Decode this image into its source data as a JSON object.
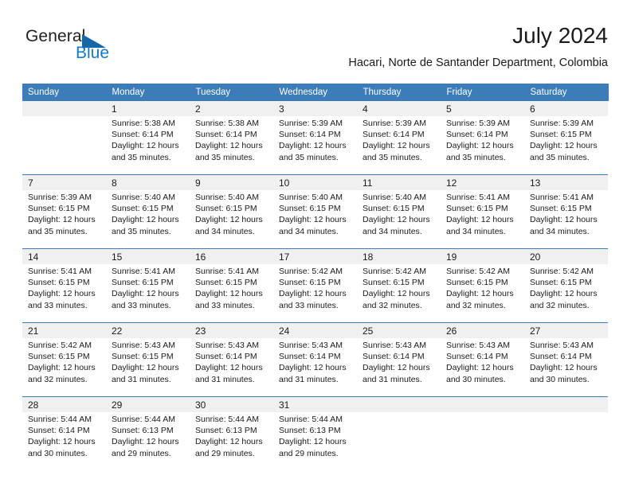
{
  "brand": {
    "name_part1": "General",
    "name_part2": "Blue",
    "logo_icon": "blue-triangle-icon"
  },
  "header": {
    "title": "July 2024",
    "subtitle": "Hacari, Norte de Santander Department, Colombia"
  },
  "colors": {
    "header_blue": "#3b7cb9",
    "brand_blue": "#1379c4",
    "logo_triangle_blue": "#1767a8",
    "date_band_gray": "#f0f0f0",
    "text": "#1a1a1a"
  },
  "calendar": {
    "weekday_headers": [
      "Sunday",
      "Monday",
      "Tuesday",
      "Wednesday",
      "Thursday",
      "Friday",
      "Saturday"
    ],
    "weeks": [
      {
        "days": [
          {
            "date": "",
            "sunrise": "",
            "sunset": "",
            "daylight_line1": "",
            "daylight_line2": ""
          },
          {
            "date": "1",
            "sunrise": "Sunrise: 5:38 AM",
            "sunset": "Sunset: 6:14 PM",
            "daylight_line1": "Daylight: 12 hours",
            "daylight_line2": "and 35 minutes."
          },
          {
            "date": "2",
            "sunrise": "Sunrise: 5:38 AM",
            "sunset": "Sunset: 6:14 PM",
            "daylight_line1": "Daylight: 12 hours",
            "daylight_line2": "and 35 minutes."
          },
          {
            "date": "3",
            "sunrise": "Sunrise: 5:39 AM",
            "sunset": "Sunset: 6:14 PM",
            "daylight_line1": "Daylight: 12 hours",
            "daylight_line2": "and 35 minutes."
          },
          {
            "date": "4",
            "sunrise": "Sunrise: 5:39 AM",
            "sunset": "Sunset: 6:14 PM",
            "daylight_line1": "Daylight: 12 hours",
            "daylight_line2": "and 35 minutes."
          },
          {
            "date": "5",
            "sunrise": "Sunrise: 5:39 AM",
            "sunset": "Sunset: 6:14 PM",
            "daylight_line1": "Daylight: 12 hours",
            "daylight_line2": "and 35 minutes."
          },
          {
            "date": "6",
            "sunrise": "Sunrise: 5:39 AM",
            "sunset": "Sunset: 6:15 PM",
            "daylight_line1": "Daylight: 12 hours",
            "daylight_line2": "and 35 minutes."
          }
        ]
      },
      {
        "days": [
          {
            "date": "7",
            "sunrise": "Sunrise: 5:39 AM",
            "sunset": "Sunset: 6:15 PM",
            "daylight_line1": "Daylight: 12 hours",
            "daylight_line2": "and 35 minutes."
          },
          {
            "date": "8",
            "sunrise": "Sunrise: 5:40 AM",
            "sunset": "Sunset: 6:15 PM",
            "daylight_line1": "Daylight: 12 hours",
            "daylight_line2": "and 35 minutes."
          },
          {
            "date": "9",
            "sunrise": "Sunrise: 5:40 AM",
            "sunset": "Sunset: 6:15 PM",
            "daylight_line1": "Daylight: 12 hours",
            "daylight_line2": "and 34 minutes."
          },
          {
            "date": "10",
            "sunrise": "Sunrise: 5:40 AM",
            "sunset": "Sunset: 6:15 PM",
            "daylight_line1": "Daylight: 12 hours",
            "daylight_line2": "and 34 minutes."
          },
          {
            "date": "11",
            "sunrise": "Sunrise: 5:40 AM",
            "sunset": "Sunset: 6:15 PM",
            "daylight_line1": "Daylight: 12 hours",
            "daylight_line2": "and 34 minutes."
          },
          {
            "date": "12",
            "sunrise": "Sunrise: 5:41 AM",
            "sunset": "Sunset: 6:15 PM",
            "daylight_line1": "Daylight: 12 hours",
            "daylight_line2": "and 34 minutes."
          },
          {
            "date": "13",
            "sunrise": "Sunrise: 5:41 AM",
            "sunset": "Sunset: 6:15 PM",
            "daylight_line1": "Daylight: 12 hours",
            "daylight_line2": "and 34 minutes."
          }
        ]
      },
      {
        "days": [
          {
            "date": "14",
            "sunrise": "Sunrise: 5:41 AM",
            "sunset": "Sunset: 6:15 PM",
            "daylight_line1": "Daylight: 12 hours",
            "daylight_line2": "and 33 minutes."
          },
          {
            "date": "15",
            "sunrise": "Sunrise: 5:41 AM",
            "sunset": "Sunset: 6:15 PM",
            "daylight_line1": "Daylight: 12 hours",
            "daylight_line2": "and 33 minutes."
          },
          {
            "date": "16",
            "sunrise": "Sunrise: 5:41 AM",
            "sunset": "Sunset: 6:15 PM",
            "daylight_line1": "Daylight: 12 hours",
            "daylight_line2": "and 33 minutes."
          },
          {
            "date": "17",
            "sunrise": "Sunrise: 5:42 AM",
            "sunset": "Sunset: 6:15 PM",
            "daylight_line1": "Daylight: 12 hours",
            "daylight_line2": "and 33 minutes."
          },
          {
            "date": "18",
            "sunrise": "Sunrise: 5:42 AM",
            "sunset": "Sunset: 6:15 PM",
            "daylight_line1": "Daylight: 12 hours",
            "daylight_line2": "and 32 minutes."
          },
          {
            "date": "19",
            "sunrise": "Sunrise: 5:42 AM",
            "sunset": "Sunset: 6:15 PM",
            "daylight_line1": "Daylight: 12 hours",
            "daylight_line2": "and 32 minutes."
          },
          {
            "date": "20",
            "sunrise": "Sunrise: 5:42 AM",
            "sunset": "Sunset: 6:15 PM",
            "daylight_line1": "Daylight: 12 hours",
            "daylight_line2": "and 32 minutes."
          }
        ]
      },
      {
        "days": [
          {
            "date": "21",
            "sunrise": "Sunrise: 5:42 AM",
            "sunset": "Sunset: 6:15 PM",
            "daylight_line1": "Daylight: 12 hours",
            "daylight_line2": "and 32 minutes."
          },
          {
            "date": "22",
            "sunrise": "Sunrise: 5:43 AM",
            "sunset": "Sunset: 6:15 PM",
            "daylight_line1": "Daylight: 12 hours",
            "daylight_line2": "and 31 minutes."
          },
          {
            "date": "23",
            "sunrise": "Sunrise: 5:43 AM",
            "sunset": "Sunset: 6:14 PM",
            "daylight_line1": "Daylight: 12 hours",
            "daylight_line2": "and 31 minutes."
          },
          {
            "date": "24",
            "sunrise": "Sunrise: 5:43 AM",
            "sunset": "Sunset: 6:14 PM",
            "daylight_line1": "Daylight: 12 hours",
            "daylight_line2": "and 31 minutes."
          },
          {
            "date": "25",
            "sunrise": "Sunrise: 5:43 AM",
            "sunset": "Sunset: 6:14 PM",
            "daylight_line1": "Daylight: 12 hours",
            "daylight_line2": "and 31 minutes."
          },
          {
            "date": "26",
            "sunrise": "Sunrise: 5:43 AM",
            "sunset": "Sunset: 6:14 PM",
            "daylight_line1": "Daylight: 12 hours",
            "daylight_line2": "and 30 minutes."
          },
          {
            "date": "27",
            "sunrise": "Sunrise: 5:43 AM",
            "sunset": "Sunset: 6:14 PM",
            "daylight_line1": "Daylight: 12 hours",
            "daylight_line2": "and 30 minutes."
          }
        ]
      },
      {
        "days": [
          {
            "date": "28",
            "sunrise": "Sunrise: 5:44 AM",
            "sunset": "Sunset: 6:14 PM",
            "daylight_line1": "Daylight: 12 hours",
            "daylight_line2": "and 30 minutes."
          },
          {
            "date": "29",
            "sunrise": "Sunrise: 5:44 AM",
            "sunset": "Sunset: 6:13 PM",
            "daylight_line1": "Daylight: 12 hours",
            "daylight_line2": "and 29 minutes."
          },
          {
            "date": "30",
            "sunrise": "Sunrise: 5:44 AM",
            "sunset": "Sunset: 6:13 PM",
            "daylight_line1": "Daylight: 12 hours",
            "daylight_line2": "and 29 minutes."
          },
          {
            "date": "31",
            "sunrise": "Sunrise: 5:44 AM",
            "sunset": "Sunset: 6:13 PM",
            "daylight_line1": "Daylight: 12 hours",
            "daylight_line2": "and 29 minutes."
          },
          {
            "date": "",
            "sunrise": "",
            "sunset": "",
            "daylight_line1": "",
            "daylight_line2": ""
          },
          {
            "date": "",
            "sunrise": "",
            "sunset": "",
            "daylight_line1": "",
            "daylight_line2": ""
          },
          {
            "date": "",
            "sunrise": "",
            "sunset": "",
            "daylight_line1": "",
            "daylight_line2": ""
          }
        ]
      }
    ]
  }
}
